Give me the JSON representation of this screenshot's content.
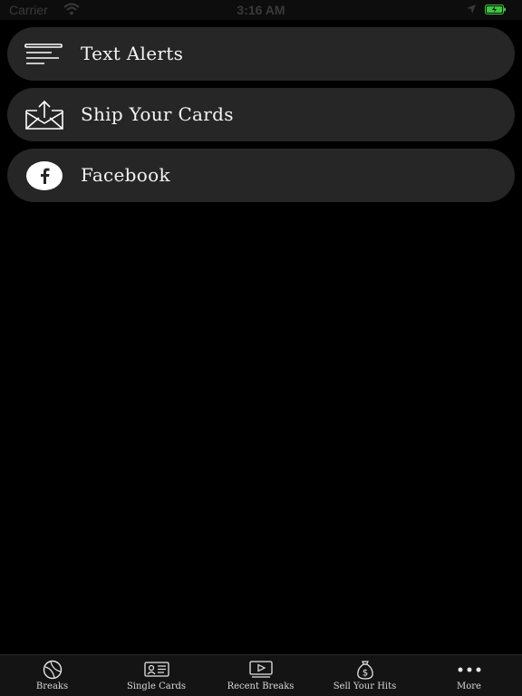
{
  "status_bar": {
    "carrier": "Carrier",
    "time": "3:16 AM"
  },
  "menu": {
    "items": [
      {
        "label": "Text Alerts",
        "icon": "text-lines-icon"
      },
      {
        "label": "Ship Your Cards",
        "icon": "envelope-upload-icon"
      },
      {
        "label": "Facebook",
        "icon": "facebook-icon"
      }
    ]
  },
  "tab_bar": {
    "tabs": [
      {
        "label": "Breaks",
        "icon": "baseball-icon"
      },
      {
        "label": "Single Cards",
        "icon": "card-icon"
      },
      {
        "label": "Recent Breaks",
        "icon": "video-play-icon"
      },
      {
        "label": "Sell Your Hits",
        "icon": "money-bag-icon"
      },
      {
        "label": "More",
        "icon": "more-dots-icon"
      }
    ]
  },
  "colors": {
    "background": "#000000",
    "row_background": "#262626",
    "text": "#f4f4f4",
    "battery": "#3ec43e"
  }
}
